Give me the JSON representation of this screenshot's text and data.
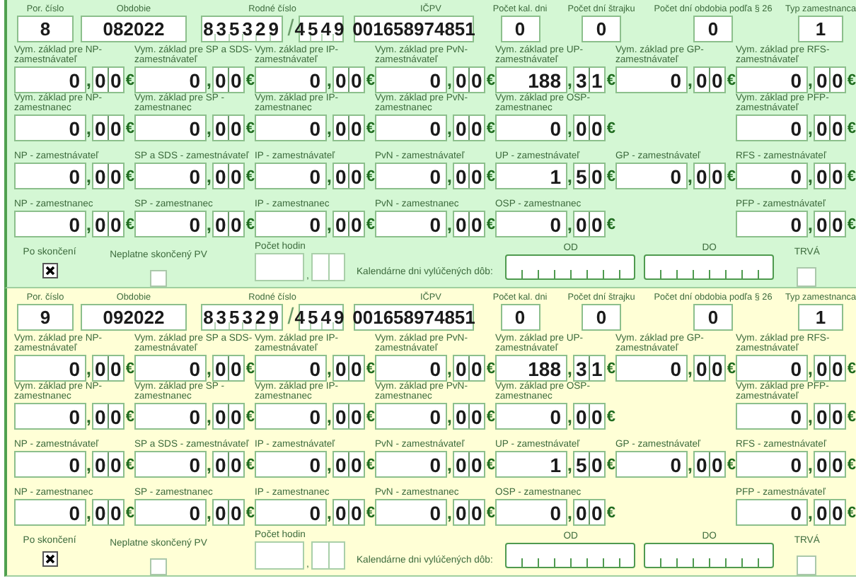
{
  "records": [
    {
      "color": "#d4f7d4",
      "header_fields": [
        {
          "kind": "box",
          "label": "Por. číslo",
          "value": "8"
        },
        {
          "kind": "box",
          "label": "Obdobie",
          "value": "082022"
        },
        {
          "kind": "birth_number",
          "label": "Rodné číslo",
          "first": "835329",
          "separator": "/",
          "second": "4549"
        },
        {
          "kind": "box",
          "label": "IČPV",
          "value": "001658974851"
        },
        {
          "kind": "box",
          "label": "Počet kal. dni",
          "value": "0"
        },
        {
          "kind": "box",
          "label": "Počet dní štrajku",
          "value": "0"
        },
        {
          "kind": "box",
          "label": "Počet dní obdobia podľa § 26",
          "value": "0"
        },
        {
          "kind": "box",
          "label": "Typ zamestnanca",
          "value": "1"
        }
      ],
      "rows": [
        [
          {
            "kind": "amount",
            "label": "Vym. základ pre NP-zamestnávateľ",
            "whole": "0",
            "separator": ",",
            "cents": [
              "0",
              "0"
            ],
            "currency": "€"
          },
          {
            "kind": "amount",
            "label": "Vym. základ pre SP a SDS-zamestnávateľ",
            "whole": "0",
            "separator": ",",
            "cents": [
              "0",
              "0"
            ],
            "currency": "€"
          },
          {
            "kind": "amount",
            "label": "Vym. základ pre IP-zamestnávateľ",
            "whole": "0",
            "separator": ",",
            "cents": [
              "0",
              "0"
            ],
            "currency": "€"
          },
          {
            "kind": "amount",
            "label": "Vym. základ pre PvN-zamestnávateľ",
            "whole": "0",
            "separator": ",",
            "cents": [
              "0",
              "0"
            ],
            "currency": "€"
          },
          {
            "kind": "amount",
            "label": "Vym. základ pre UP-zamestnávateľ",
            "whole": "188",
            "separator": ",",
            "cents": [
              "3",
              "1"
            ],
            "currency": "€"
          },
          {
            "kind": "amount",
            "label": "Vym. základ pre GP-zamestnávateľ",
            "whole": "0",
            "separator": ",",
            "cents": [
              "0",
              "0"
            ],
            "currency": "€"
          },
          {
            "kind": "amount",
            "label": "Vym. základ pre RFS-zamestnávateľ",
            "whole": "0",
            "separator": ",",
            "cents": [
              "0",
              "0"
            ],
            "currency": "€"
          }
        ],
        [
          {
            "kind": "amount",
            "label": "Vym. základ pre NP-zamestnanec",
            "whole": "0",
            "separator": ",",
            "cents": [
              "0",
              "0"
            ],
            "currency": "€"
          },
          {
            "kind": "amount",
            "label": "Vym. základ pre SP - zamestnanec",
            "whole": "0",
            "separator": ",",
            "cents": [
              "0",
              "0"
            ],
            "currency": "€"
          },
          {
            "kind": "amount",
            "label": "Vym. základ pre IP-zamestnanec",
            "whole": "0",
            "separator": ",",
            "cents": [
              "0",
              "0"
            ],
            "currency": "€"
          },
          {
            "kind": "amount",
            "label": "Vym. základ pre PvN-zamestnanec",
            "whole": "0",
            "separator": ",",
            "cents": [
              "0",
              "0"
            ],
            "currency": "€"
          },
          {
            "kind": "amount",
            "label": "Vym. základ pre OSP-zamestnanec",
            "whole": "0",
            "separator": ",",
            "cents": [
              "0",
              "0"
            ],
            "currency": "€"
          },
          {
            "kind": "blank"
          },
          {
            "kind": "amount",
            "label": "Vym. základ pre PFP-zamestnávateľ",
            "whole": "0",
            "separator": ",",
            "cents": [
              "0",
              "0"
            ],
            "currency": "€"
          }
        ],
        [
          {
            "kind": "amount",
            "label": "NP - zamestnávateľ",
            "whole": "0",
            "separator": ",",
            "cents": [
              "0",
              "0"
            ],
            "currency": "€"
          },
          {
            "kind": "amount",
            "label": "SP a SDS - zamestnávateľ",
            "whole": "0",
            "separator": ",",
            "cents": [
              "0",
              "0"
            ],
            "currency": "€"
          },
          {
            "kind": "amount",
            "label": "IP - zamestnávateľ",
            "whole": "0",
            "separator": ",",
            "cents": [
              "0",
              "0"
            ],
            "currency": "€"
          },
          {
            "kind": "amount",
            "label": "PvN - zamestnávateľ",
            "whole": "0",
            "separator": ",",
            "cents": [
              "0",
              "0"
            ],
            "currency": "€"
          },
          {
            "kind": "amount",
            "label": "UP - zamestnávateľ",
            "whole": "1",
            "separator": ",",
            "cents": [
              "5",
              "0"
            ],
            "currency": "€"
          },
          {
            "kind": "amount",
            "label": "GP - zamestnávateľ",
            "whole": "0",
            "separator": ",",
            "cents": [
              "0",
              "0"
            ],
            "currency": "€"
          },
          {
            "kind": "amount",
            "label": "RFS - zamestnávateľ",
            "whole": "0",
            "separator": ",",
            "cents": [
              "0",
              "0"
            ],
            "currency": "€"
          }
        ],
        [
          {
            "kind": "amount",
            "label": "NP - zamestnanec",
            "whole": "0",
            "separator": ",",
            "cents": [
              "0",
              "0"
            ],
            "currency": "€"
          },
          {
            "kind": "amount",
            "label": "SP - zamestnanec",
            "whole": "0",
            "separator": ",",
            "cents": [
              "0",
              "0"
            ],
            "currency": "€"
          },
          {
            "kind": "amount",
            "label": "IP - zamestnanec",
            "whole": "0",
            "separator": ",",
            "cents": [
              "0",
              "0"
            ],
            "currency": "€"
          },
          {
            "kind": "amount",
            "label": "PvN - zamestnanec",
            "whole": "0",
            "separator": ",",
            "cents": [
              "0",
              "0"
            ],
            "currency": "€"
          },
          {
            "kind": "amount",
            "label": "OSP - zamestnanec",
            "whole": "0",
            "separator": ",",
            "cents": [
              "0",
              "0"
            ],
            "currency": "€"
          },
          {
            "kind": "blank"
          },
          {
            "kind": "amount",
            "label": "PFP - zamestnávateľ",
            "whole": "0",
            "separator": ",",
            "cents": [
              "0",
              "0"
            ],
            "currency": "€"
          }
        ]
      ],
      "bottom": {
        "finished": {
          "label": "Po skončení",
          "checked": true
        },
        "invalid_end": {
          "label": "Neplatne skončený PV",
          "checked": false
        },
        "hours": {
          "label": "Počet hodin",
          "separator": ","
        },
        "excluded_label": "Kalendárne dni vylúčených dôb:",
        "from": {
          "label": "OD"
        },
        "to": {
          "label": "DO"
        },
        "ongoing": {
          "label": "TRVÁ",
          "checked": false
        }
      }
    },
    {
      "color": "#ffffd6",
      "header_fields": [
        {
          "kind": "box",
          "label": "Por. číslo",
          "value": "9"
        },
        {
          "kind": "box",
          "label": "Obdobie",
          "value": "092022"
        },
        {
          "kind": "birth_number",
          "label": "Rodné číslo",
          "first": "835329",
          "separator": "/",
          "second": "4549"
        },
        {
          "kind": "box",
          "label": "IČPV",
          "value": "001658974851"
        },
        {
          "kind": "box",
          "label": "Počet kal. dni",
          "value": "0"
        },
        {
          "kind": "box",
          "label": "Počet dní štrajku",
          "value": "0"
        },
        {
          "kind": "box",
          "label": "Počet dní obdobia podľa § 26",
          "value": "0"
        },
        {
          "kind": "box",
          "label": "Typ zamestnanca",
          "value": "1"
        }
      ],
      "rows": [
        [
          {
            "kind": "amount",
            "label": "Vym. základ pre NP-zamestnávateľ",
            "whole": "0",
            "separator": ",",
            "cents": [
              "0",
              "0"
            ],
            "currency": "€"
          },
          {
            "kind": "amount",
            "label": "Vym. základ pre SP a SDS-zamestnávateľ",
            "whole": "0",
            "separator": ",",
            "cents": [
              "0",
              "0"
            ],
            "currency": "€"
          },
          {
            "kind": "amount",
            "label": "Vym. základ pre IP-zamestnávateľ",
            "whole": "0",
            "separator": ",",
            "cents": [
              "0",
              "0"
            ],
            "currency": "€"
          },
          {
            "kind": "amount",
            "label": "Vym. základ pre PvN-zamestnávateľ",
            "whole": "0",
            "separator": ",",
            "cents": [
              "0",
              "0"
            ],
            "currency": "€"
          },
          {
            "kind": "amount",
            "label": "Vym. základ pre UP-zamestnávateľ",
            "whole": "188",
            "separator": ",",
            "cents": [
              "3",
              "1"
            ],
            "currency": "€"
          },
          {
            "kind": "amount",
            "label": "Vym. základ pre GP-zamestnávateľ",
            "whole": "0",
            "separator": ",",
            "cents": [
              "0",
              "0"
            ],
            "currency": "€"
          },
          {
            "kind": "amount",
            "label": "Vym. základ pre RFS-zamestnávateľ",
            "whole": "0",
            "separator": ",",
            "cents": [
              "0",
              "0"
            ],
            "currency": "€"
          }
        ],
        [
          {
            "kind": "amount",
            "label": "Vym. základ pre NP-zamestnanec",
            "whole": "0",
            "separator": ",",
            "cents": [
              "0",
              "0"
            ],
            "currency": "€"
          },
          {
            "kind": "amount",
            "label": "Vym. základ pre SP - zamestnanec",
            "whole": "0",
            "separator": ",",
            "cents": [
              "0",
              "0"
            ],
            "currency": "€"
          },
          {
            "kind": "amount",
            "label": "Vym. základ pre IP-zamestnanec",
            "whole": "0",
            "separator": ",",
            "cents": [
              "0",
              "0"
            ],
            "currency": "€"
          },
          {
            "kind": "amount",
            "label": "Vym. základ pre PvN-zamestnanec",
            "whole": "0",
            "separator": ",",
            "cents": [
              "0",
              "0"
            ],
            "currency": "€"
          },
          {
            "kind": "amount",
            "label": "Vym. základ pre OSP-zamestnanec",
            "whole": "0",
            "separator": ",",
            "cents": [
              "0",
              "0"
            ],
            "currency": "€"
          },
          {
            "kind": "blank"
          },
          {
            "kind": "amount",
            "label": "Vym. základ pre PFP-zamestnávateľ",
            "whole": "0",
            "separator": ",",
            "cents": [
              "0",
              "0"
            ],
            "currency": "€"
          }
        ],
        [
          {
            "kind": "amount",
            "label": "NP - zamestnávateľ",
            "whole": "0",
            "separator": ",",
            "cents": [
              "0",
              "0"
            ],
            "currency": "€"
          },
          {
            "kind": "amount",
            "label": "SP a SDS - zamestnávateľ",
            "whole": "0",
            "separator": ",",
            "cents": [
              "0",
              "0"
            ],
            "currency": "€"
          },
          {
            "kind": "amount",
            "label": "IP - zamestnávateľ",
            "whole": "0",
            "separator": ",",
            "cents": [
              "0",
              "0"
            ],
            "currency": "€"
          },
          {
            "kind": "amount",
            "label": "PvN - zamestnávateľ",
            "whole": "0",
            "separator": ",",
            "cents": [
              "0",
              "0"
            ],
            "currency": "€"
          },
          {
            "kind": "amount",
            "label": "UP - zamestnávateľ",
            "whole": "1",
            "separator": ",",
            "cents": [
              "5",
              "0"
            ],
            "currency": "€"
          },
          {
            "kind": "amount",
            "label": "GP - zamestnávateľ",
            "whole": "0",
            "separator": ",",
            "cents": [
              "0",
              "0"
            ],
            "currency": "€"
          },
          {
            "kind": "amount",
            "label": "RFS - zamestnávateľ",
            "whole": "0",
            "separator": ",",
            "cents": [
              "0",
              "0"
            ],
            "currency": "€"
          }
        ],
        [
          {
            "kind": "amount",
            "label": "NP - zamestnanec",
            "whole": "0",
            "separator": ",",
            "cents": [
              "0",
              "0"
            ],
            "currency": "€"
          },
          {
            "kind": "amount",
            "label": "SP - zamestnanec",
            "whole": "0",
            "separator": ",",
            "cents": [
              "0",
              "0"
            ],
            "currency": "€"
          },
          {
            "kind": "amount",
            "label": "IP - zamestnanec",
            "whole": "0",
            "separator": ",",
            "cents": [
              "0",
              "0"
            ],
            "currency": "€"
          },
          {
            "kind": "amount",
            "label": "PvN - zamestnanec",
            "whole": "0",
            "separator": ",",
            "cents": [
              "0",
              "0"
            ],
            "currency": "€"
          },
          {
            "kind": "amount",
            "label": "OSP - zamestnanec",
            "whole": "0",
            "separator": ",",
            "cents": [
              "0",
              "0"
            ],
            "currency": "€"
          },
          {
            "kind": "blank"
          },
          {
            "kind": "amount",
            "label": "PFP - zamestnávateľ",
            "whole": "0",
            "separator": ",",
            "cents": [
              "0",
              "0"
            ],
            "currency": "€"
          }
        ]
      ],
      "bottom": {
        "finished": {
          "label": "Po skončení",
          "checked": true
        },
        "invalid_end": {
          "label": "Neplatne skončený PV",
          "checked": false
        },
        "hours": {
          "label": "Počet hodin",
          "separator": ","
        },
        "excluded_label": "Kalendárne dni vylúčených dôb:",
        "from": {
          "label": "OD"
        },
        "to": {
          "label": "DO"
        },
        "ongoing": {
          "label": "TRVÁ",
          "checked": false
        }
      }
    }
  ]
}
